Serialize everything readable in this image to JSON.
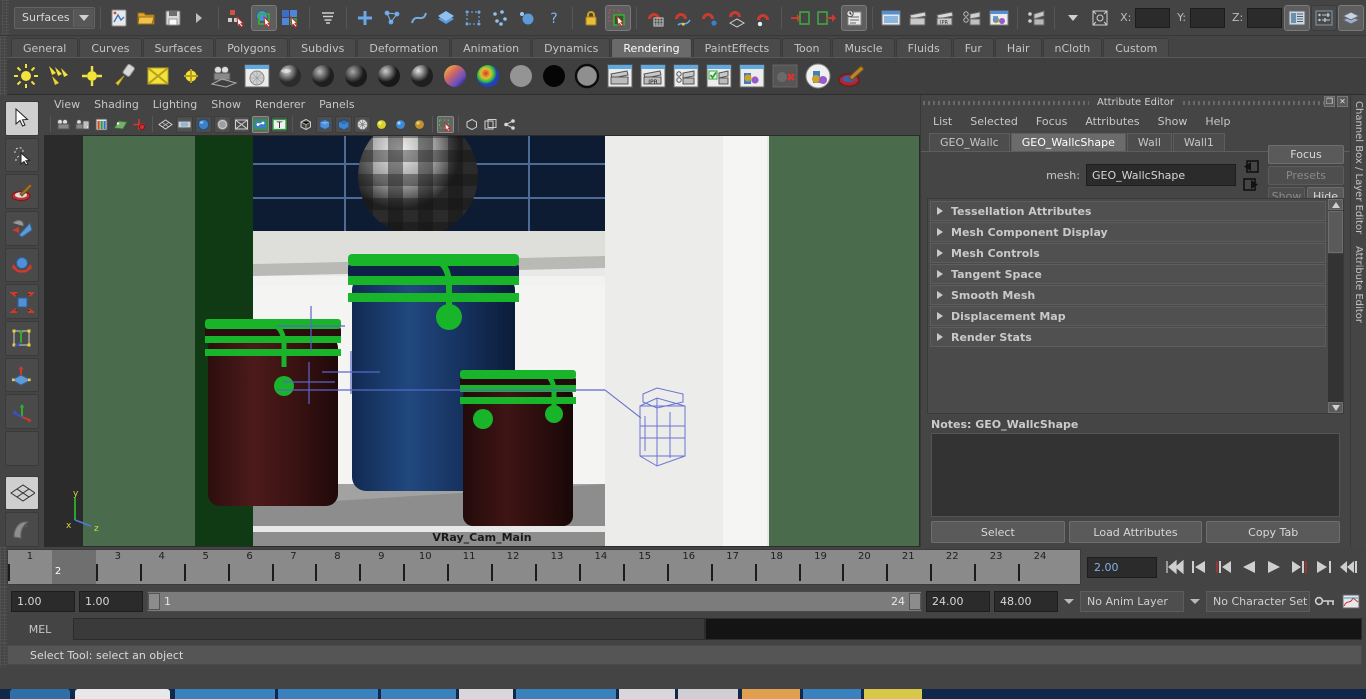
{
  "status_line": {
    "menu_set": "Surfaces",
    "coord_labels": [
      "X:",
      "Y:",
      "Z:"
    ],
    "coord_values": [
      "",
      "",
      ""
    ],
    "icons": [
      "new-scene-icon",
      "open-scene-icon",
      "save-scene-icon",
      "undo-arrow-icon",
      "select-by-hierarchy-icon",
      "select-by-object-icon",
      "select-by-component-icon",
      "highlight-selection-icon",
      "snap-to-grid-icon",
      "snap-to-curve-icon",
      "snap-to-point-icon",
      "snap-to-projected-center-icon",
      "snap-to-view-plane-icon",
      "make-live-icon",
      "input-connections-icon",
      "output-connections-icon",
      "construction-history-icon",
      "render-view-icon",
      "render-sequence-icon",
      "ipr-render-icon",
      "render-settings-icon",
      "hypershade-icon",
      "selection-mask-icon",
      "lock-icon",
      "show-manipulator-icon"
    ],
    "right_icons": [
      "attribute-editor-icon",
      "channel-box-icon",
      "layer-editor-icon"
    ]
  },
  "shelf": {
    "tabs": [
      "General",
      "Curves",
      "Surfaces",
      "Polygons",
      "Subdivs",
      "Deformation",
      "Animation",
      "Dynamics",
      "Rendering",
      "PaintEffects",
      "Toon",
      "Muscle",
      "Fluids",
      "Fur",
      "Hair",
      "nCloth",
      "Custom"
    ],
    "active_tab": "Rendering",
    "icons": [
      "ambient-light-icon",
      "directional-light-icon",
      "point-light-icon",
      "spot-light-icon",
      "area-light-icon",
      "volume-light-icon",
      "camera-icon",
      "render-view-icon",
      "anisotropic-material-icon",
      "blinn-material-icon",
      "lambert-material-icon",
      "phong-material-icon",
      "phonge-material-icon",
      "layered-shader-icon",
      "ramp-shader-icon",
      "surface-shader-icon",
      "use-background-icon",
      "shading-map-icon",
      "render-current-frame-icon",
      "ipr-render-icon",
      "batch-render-icon",
      "render-settings-icon",
      "hypershade-icon",
      "delete-unused-nodes-icon",
      "render-layer-icon",
      "paint-vertex-color-icon"
    ]
  },
  "toolbox": {
    "tools": [
      "select-tool-icon",
      "lasso-select-tool-icon",
      "paint-select-tool-icon",
      "move-tool-icon",
      "rotate-tool-icon",
      "scale-tool-icon",
      "universal-manipulator-icon",
      "soft-modification-tool-icon",
      "show-manipulator-tool-icon",
      "last-tool-icon"
    ],
    "active_tool": "select-tool-icon",
    "layout_icons": [
      "single-perspective-layout-icon",
      "persp-outliner-layout-icon"
    ]
  },
  "viewport": {
    "menus": [
      "View",
      "Shading",
      "Lighting",
      "Show",
      "Renderer",
      "Panels"
    ],
    "toolbar_icons": [
      "select-camera-icon",
      "camera-attributes-icon",
      "bookmark-icon",
      "image-plane-icon",
      "two-d-pan-zoom-icon",
      "grid-toggle-icon",
      "film-gate-icon",
      "resolution-gate-icon",
      "gate-mask-icon",
      "exposure-icon",
      "texture-toggle-icon",
      "xray-icon",
      "text-toggle-icon",
      "wireframe-shading-icon",
      "smooth-shading-icon",
      "smooth-shade-all-icon",
      "textured-shading-icon",
      "use-default-light-icon",
      "use-all-lights-icon",
      "shadows-icon",
      "isolate-select-icon",
      "xray-joints-icon",
      "smooth-wireframe-icon",
      "component-editor-icon"
    ],
    "camera_label": "VRay_Cam_Main",
    "axis_labels": [
      "y",
      "x",
      "z"
    ]
  },
  "attribute_editor": {
    "title": "Attribute Editor",
    "menus": [
      "List",
      "Selected",
      "Focus",
      "Attributes",
      "Show",
      "Help"
    ],
    "tabs": [
      "GEO_Wallc",
      "GEO_WallcShape",
      "Wall",
      "Wall1"
    ],
    "active_tab": "GEO_WallcShape",
    "node_type_label": "mesh:",
    "node_name": "GEO_WallcShape",
    "buttons": {
      "focus": "Focus",
      "presets": "Presets",
      "show": "Show",
      "hide": "Hide"
    },
    "sections": [
      "Tessellation Attributes",
      "Mesh Component Display",
      "Mesh Controls",
      "Tangent Space",
      "Smooth Mesh",
      "Displacement Map",
      "Render Stats"
    ],
    "notes_label": "Notes: GEO_WallcShape",
    "notes_value": "",
    "actions": [
      "Select",
      "Load Attributes",
      "Copy Tab"
    ]
  },
  "right_dock_tabs": [
    "Channel Box / Layer Editor",
    "Attribute Editor"
  ],
  "time_slider": {
    "ticks": [
      1,
      2,
      3,
      4,
      5,
      6,
      7,
      8,
      9,
      10,
      11,
      12,
      13,
      14,
      15,
      16,
      17,
      18,
      19,
      20,
      21,
      22,
      23,
      24
    ],
    "current_frame": "2",
    "current_time_field": "2.00",
    "playback_icons": [
      "go-to-start-icon",
      "step-back-keyframe-icon",
      "step-back-frame-icon",
      "play-backwards-icon",
      "play-forwards-icon",
      "step-forward-frame-icon",
      "step-forward-keyframe-icon",
      "go-to-end-icon"
    ]
  },
  "range_slider": {
    "anim_start": "1.00",
    "anim_end": "1.00",
    "range_start": "1",
    "range_end": "24",
    "playback_end": "24.00",
    "anim_range_end": "48.00",
    "anim_layer": "No Anim Layer",
    "character_set": "No Character Set",
    "icons": [
      "auto-key-icon",
      "animation-preferences-icon"
    ]
  },
  "command_line": {
    "language_label": "MEL",
    "input_value": "",
    "output_value": ""
  },
  "help_line": {
    "text": "Select Tool: select an object"
  },
  "colors": {
    "bg": "#444444",
    "panel": "#454545",
    "accent_blue": "#7fb2e8",
    "tab_active": "#6b6b6b",
    "field_bg": "#2b2b2b",
    "timeline": "#8a8a8a",
    "jar_green": "#19b028",
    "jar_blue": "#1d3f7a",
    "jar_maroon": "#3a1414"
  }
}
